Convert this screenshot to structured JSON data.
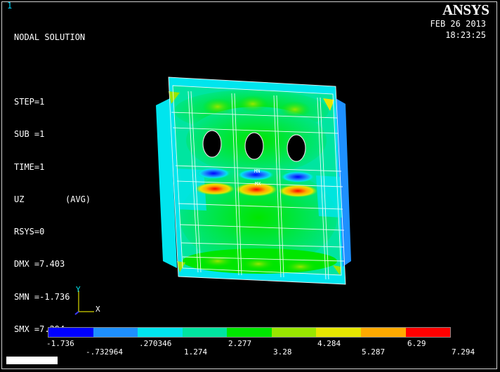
{
  "window_number": "1",
  "title": "NODAL SOLUTION",
  "step": "STEP=1",
  "sub": "SUB =1",
  "time": "TIME=1",
  "component": "UZ",
  "averaging": "(AVG)",
  "rsys": "RSYS=0",
  "dmx": "DMX =7.403",
  "smn": "SMN =-1.736",
  "smx": "SMX =7.294",
  "logo": {
    "an": "AN",
    "sys": "SYS"
  },
  "date": "FEB 26 2013",
  "time_of_day": "18:23:25",
  "triad": {
    "y": "Y",
    "x": "X"
  },
  "contour_labels": {
    "l0": "-1.736",
    "l1": "-.732964",
    "l2": ".270346",
    "l3": "1.274",
    "l4": "2.277",
    "l5": "3.28",
    "l6": "4.284",
    "l7": "5.287",
    "l8": "6.29",
    "l9": "7.294"
  },
  "contour_colors": [
    "#0000ff",
    "#1e90ff",
    "#00e5ee",
    "#00e5a0",
    "#00e600",
    "#99e600",
    "#e6e600",
    "#ffaa00",
    "#ff0000"
  ],
  "colors": {
    "background": "#000000",
    "text": "#ffffff",
    "window_number": "#00d9ff"
  }
}
